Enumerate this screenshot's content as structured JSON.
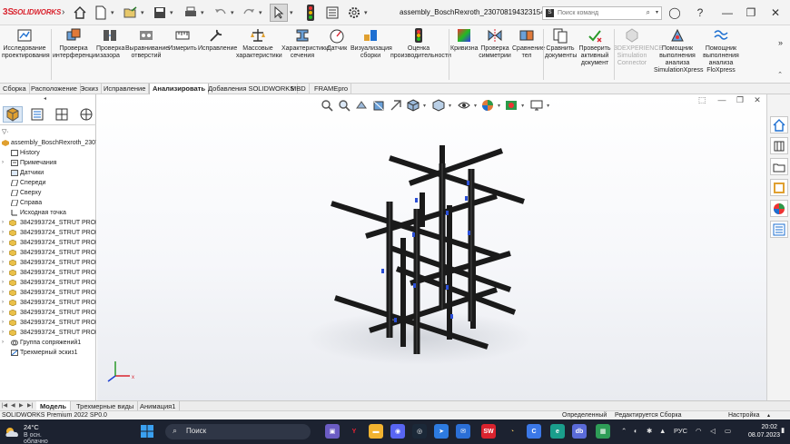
{
  "app": {
    "brand": "SOLIDWORKS",
    "window_title": "assembly_BoschRexroth_230708194323154 *",
    "search_placeholder": "Поиск команд"
  },
  "ribbon": {
    "items": [
      {
        "label": "Исследование проектирования",
        "icon": "design-study-icon"
      },
      {
        "label": "Проверка интерференции",
        "icon": "interference-icon"
      },
      {
        "label": "Проверка зазора",
        "icon": "clearance-icon"
      },
      {
        "label": "Выравнивание отверстий",
        "icon": "hole-align-icon"
      },
      {
        "label": "Измерить",
        "icon": "measure-icon"
      },
      {
        "label": "Исправление",
        "icon": "repair-icon"
      },
      {
        "label": "Массовые характеристики",
        "icon": "mass-properties-icon"
      },
      {
        "label": "Характеристики сечения",
        "icon": "section-properties-icon"
      },
      {
        "label": "Датчик",
        "icon": "sensor-icon"
      },
      {
        "label": "Визуализация сборки",
        "icon": "assembly-visualization-icon"
      },
      {
        "label": "Оценка производительности",
        "icon": "performance-icon"
      },
      {
        "label": "Кривизна",
        "icon": "curvature-icon"
      },
      {
        "label": "Проверка симметрии",
        "icon": "symmetry-icon"
      },
      {
        "label": "Сравнение тел",
        "icon": "compare-bodies-icon"
      },
      {
        "label": "Сравнить документы",
        "icon": "compare-docs-icon"
      },
      {
        "label": "Проверить активный документ",
        "icon": "check-doc-icon"
      },
      {
        "label": "3DEXPERIENCE Simulation Connector",
        "icon": "3dx-connector-icon"
      },
      {
        "label": "Помощник выполнения анализа SimulationXpress",
        "icon": "simulationxpress-icon"
      },
      {
        "label": "Помощник выполнения анализа FloXpress",
        "icon": "floxpress-icon"
      }
    ]
  },
  "tabs": [
    "Сборка",
    "Расположение",
    "Эскиз",
    "Исправление",
    "Анализировать",
    "Добавления SOLIDWORKS",
    "MBD",
    "FRAMEpro"
  ],
  "active_tab": "Анализировать",
  "tree": {
    "root": "assembly_BoschRexroth_23070",
    "fixed": [
      "History",
      "Примечания",
      "Датчики",
      "Спереди",
      "Сверху",
      "Справа",
      "Исходная точка"
    ],
    "parts": [
      "3842993724_STRUT PROFIL",
      "3842993724_STRUT PROFIL",
      "3842993724_STRUT PROFIL",
      "3842993724_STRUT PROFIL",
      "3842993724_STRUT PROFIL",
      "3842993724_STRUT PROFIL",
      "3842993724_STRUT PROFIL",
      "3842993724_STRUT PROFIL",
      "3842993724_STRUT PROFIL",
      "3842993724_STRUT PROFIL",
      "3842993724_STRUT PROFIL",
      "3842993724_STRUT PROFIL"
    ],
    "mates": "Группа сопряжений1",
    "sketch3d": "Трехмерный эскиз1"
  },
  "model_tabs": [
    "Модель",
    "Трехмерные виды",
    "Анимация1"
  ],
  "status": {
    "product": "SOLIDWORKS Premium 2022 SP0.0",
    "state": "Определенный",
    "editing": "Редактируется Сборка",
    "custom": "Настройка"
  },
  "taskbar": {
    "temp": "24°C",
    "condition": "В осн. облачно",
    "search": "Поиск",
    "lang": "РУС",
    "time": "20:02",
    "date": "08.07.2023"
  },
  "colors": {
    "accent": "#d9232e",
    "profile": "#1a1a1a",
    "taskbar": "#1c2230"
  }
}
